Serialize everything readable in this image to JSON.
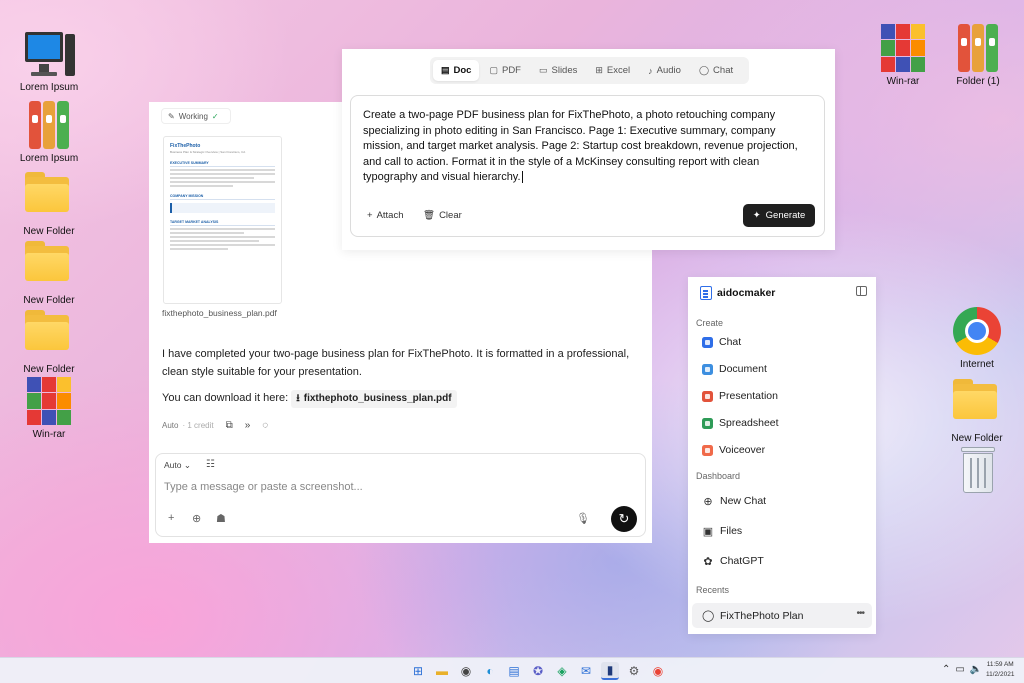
{
  "desktop": {
    "left_icons": [
      {
        "label": "Lorem Ipsum",
        "icon": "computer-icon"
      },
      {
        "label": "Lorem Ipsum",
        "icon": "binders-icon"
      },
      {
        "label": "New Folder",
        "icon": "folder-icon"
      },
      {
        "label": "New Folder",
        "icon": "folder-icon"
      },
      {
        "label": "New Folder",
        "icon": "folder-icon"
      },
      {
        "label": "Win-rar",
        "icon": "winrar-icon"
      }
    ],
    "right_icons": [
      {
        "label": "Win-rar",
        "icon": "winrar-icon"
      },
      {
        "label": "Folder (1)",
        "icon": "binders-icon"
      },
      {
        "label": "Internet",
        "icon": "chrome-icon"
      },
      {
        "label": "New Folder",
        "icon": "folder-icon"
      },
      {
        "label": "",
        "icon": "recycle-bin-icon"
      }
    ]
  },
  "chat_window": {
    "working_label": "Working",
    "pdf_preview": {
      "title": "FixThePhoto",
      "subtitle": "Business Plan & Strategic Overview | San Francisco, CA",
      "sections": [
        "EXECUTIVE SUMMARY",
        "COMPANY MISSION",
        "TARGET MARKET ANALYSIS"
      ]
    },
    "file_name": "fixthephoto_business_plan.pdf",
    "message_line1": "I have completed your two-page business plan for FixThePhoto. It is formatted in a professional, clean style suitable for your presentation.",
    "download_prefix": "You can download it here:",
    "download_link": "fixthephoto_business_plan.pdf",
    "meta_mode": "Auto",
    "meta_credit": "· 1 credit",
    "composer": {
      "mode": "Auto",
      "placeholder": "Type a message or paste a screenshot..."
    }
  },
  "generator": {
    "tabs": [
      {
        "label": "Doc",
        "icon": "doc-icon",
        "active": true
      },
      {
        "label": "PDF",
        "icon": "pdf-icon",
        "active": false
      },
      {
        "label": "Slides",
        "icon": "slides-icon",
        "active": false
      },
      {
        "label": "Excel",
        "icon": "excel-icon",
        "active": false
      },
      {
        "label": "Audio",
        "icon": "mic-icon",
        "active": false
      },
      {
        "label": "Chat",
        "icon": "chat-icon",
        "active": false
      }
    ],
    "prompt": "Create a two-page PDF business plan for FixThePhoto, a photo retouching company specializing in photo editing in San Francisco. Page 1: Executive summary, company mission, and target market analysis. Page 2: Startup cost breakdown, revenue projection, and call to action. Format it in the style of a McKinsey consulting report with clean typography and visual hierarchy.",
    "attach_label": "Attach",
    "clear_label": "Clear",
    "generate_label": "Generate"
  },
  "sidebar": {
    "brand": "aidocmaker",
    "create_heading": "Create",
    "create_items": [
      {
        "label": "Chat",
        "color": "#2f6ee8"
      },
      {
        "label": "Document",
        "color": "#3d8fe0"
      },
      {
        "label": "Presentation",
        "color": "#e2533b"
      },
      {
        "label": "Spreadsheet",
        "color": "#2e9b57"
      },
      {
        "label": "Voiceover",
        "color": "#f06a4a"
      }
    ],
    "dashboard_heading": "Dashboard",
    "dashboard_items": [
      {
        "label": "New Chat",
        "icon": "new-chat-icon"
      },
      {
        "label": "Files",
        "icon": "files-icon"
      },
      {
        "label": "ChatGPT",
        "icon": "chatgpt-icon"
      }
    ],
    "recents_heading": "Recents",
    "recent_item": "FixThePhoto Plan"
  },
  "taskbar": {
    "time": "11:59 AM",
    "date": "11/2/2021"
  }
}
